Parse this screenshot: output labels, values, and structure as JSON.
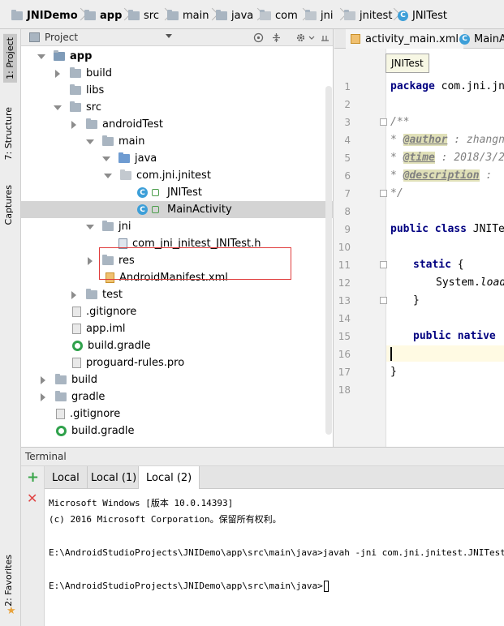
{
  "breadcrumb": [
    "JNIDemo",
    "app",
    "src",
    "main",
    "java",
    "com",
    "jni",
    "jnitest",
    "JNITest"
  ],
  "left_strip": {
    "project_tab": "1: Project",
    "structure_tab": "7: Structure",
    "captures_tab": "Captures",
    "favorites_tab": "2: Favorites"
  },
  "project_panel": {
    "title": "Project",
    "tree": [
      {
        "label": "app"
      },
      {
        "label": "build"
      },
      {
        "label": "libs"
      },
      {
        "label": "src"
      },
      {
        "label": "androidTest"
      },
      {
        "label": "main"
      },
      {
        "label": "java"
      },
      {
        "label": "com.jni.jnitest"
      },
      {
        "label": "JNITest"
      },
      {
        "label": "MainActivity"
      },
      {
        "label": "jni"
      },
      {
        "label": "com_jni_jnitest_JNITest.h"
      },
      {
        "label": "res"
      },
      {
        "label": "AndroidManifest.xml"
      },
      {
        "label": "test"
      },
      {
        "label": ".gitignore"
      },
      {
        "label": "app.iml"
      },
      {
        "label": "build.gradle"
      },
      {
        "label": "proguard-rules.pro"
      },
      {
        "label": "build"
      },
      {
        "label": "gradle"
      },
      {
        "label": ".gitignore"
      },
      {
        "label": "build.gradle"
      }
    ]
  },
  "editor": {
    "tabs": [
      "activity_main.xml",
      "MainA"
    ],
    "tooltip": "JNITest",
    "line_numbers": [
      "1",
      "2",
      "3",
      "4",
      "5",
      "6",
      "7",
      "8",
      "9",
      "10",
      "11",
      "12",
      "13",
      "14",
      "15",
      "16",
      "17",
      "18"
    ],
    "code": {
      "l1_kw": "package",
      "l1_rest": " com.jni.jni",
      "l3": "/**",
      "l4_tag": "@author",
      "l4_rest": " : zhangn",
      "l5_tag": "@time",
      "l5_rest": " : 2018/3/2",
      "l6_tag": "@description",
      "l6_rest": " :",
      "l7": " */",
      "l9_kw": "public class",
      "l9_rest": " JNITes",
      "l11_kw": "static",
      "l11_rest": " {",
      "l12_a": "System.",
      "l12_b": "loadL",
      "l13": "}",
      "l15_kw": "public native",
      "l15_rest": " :",
      "l17": "}"
    }
  },
  "terminal": {
    "title": "Terminal",
    "tabs": [
      "Local",
      "Local (1)",
      "Local (2)"
    ],
    "lines": [
      "Microsoft Windows [版本 10.0.14393]",
      "(c) 2016 Microsoft Corporation。保留所有权利。",
      "E:\\AndroidStudioProjects\\JNIDemo\\app\\src\\main\\java>javah -jni com.jni.jnitest.JNITest",
      "E:\\AndroidStudioProjects\\JNIDemo\\app\\src\\main\\java>"
    ]
  },
  "colors": {
    "keyword": "#000080",
    "comment": "#808080",
    "class_icon": "#3d9fd8",
    "annotation_box": "#e03c3c",
    "add_icon": "#3aa54a",
    "close_icon": "#e04545"
  }
}
